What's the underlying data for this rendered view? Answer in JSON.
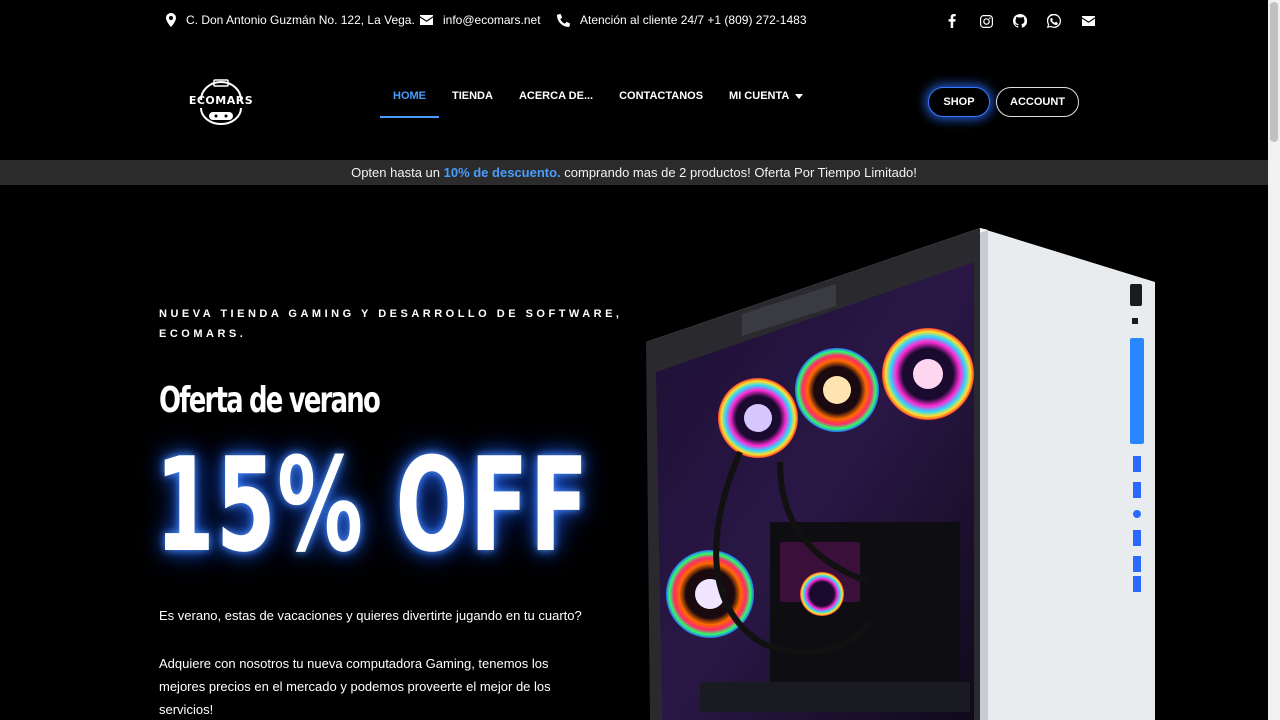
{
  "topbar": {
    "address": "C. Don Antonio Guzmán No. 122, La Vega.",
    "email": "info@ecomars.net",
    "phone": "Atención al cliente 24/7 +1 (809) 272-1483",
    "socials": [
      "facebook-icon",
      "instagram-icon",
      "github-icon",
      "whatsapp-icon",
      "envelope-icon"
    ]
  },
  "header": {
    "logo_text": "ECOMARS",
    "nav": [
      {
        "label": "HOME",
        "active": true
      },
      {
        "label": "TIENDA"
      },
      {
        "label": "ACERCA DE..."
      },
      {
        "label": "CONTACTANOS"
      },
      {
        "label": "MI CUENTA",
        "dropdown": true
      }
    ],
    "shop_label": "SHOP",
    "account_label": "ACCOUNT"
  },
  "promo": {
    "before": "Opten hasta un ",
    "highlight": "10% de descuento.",
    "after": " comprando mas de 2 productos! Oferta Por Tiempo Limitado!"
  },
  "hero": {
    "kicker": "NUEVA TIENDA GAMING Y DESARROLLO DE SOFTWARE, ECOMARS.",
    "subtitle": "Oferta de verano",
    "big": "15% OFF",
    "p1": "Es verano, estas de vacaciones y quieres divertirte jugando en tu cuarto?",
    "p2": "Adquiere con nosotros tu nueva computadora Gaming, tenemos los mejores precios en el mercado y podemos proveerte el mejor de los servicios!"
  },
  "colors": {
    "accent": "#4a9cff",
    "glow": "#286eff",
    "promo_bg": "#2b2b2b",
    "case_white": "#e9ecef"
  }
}
